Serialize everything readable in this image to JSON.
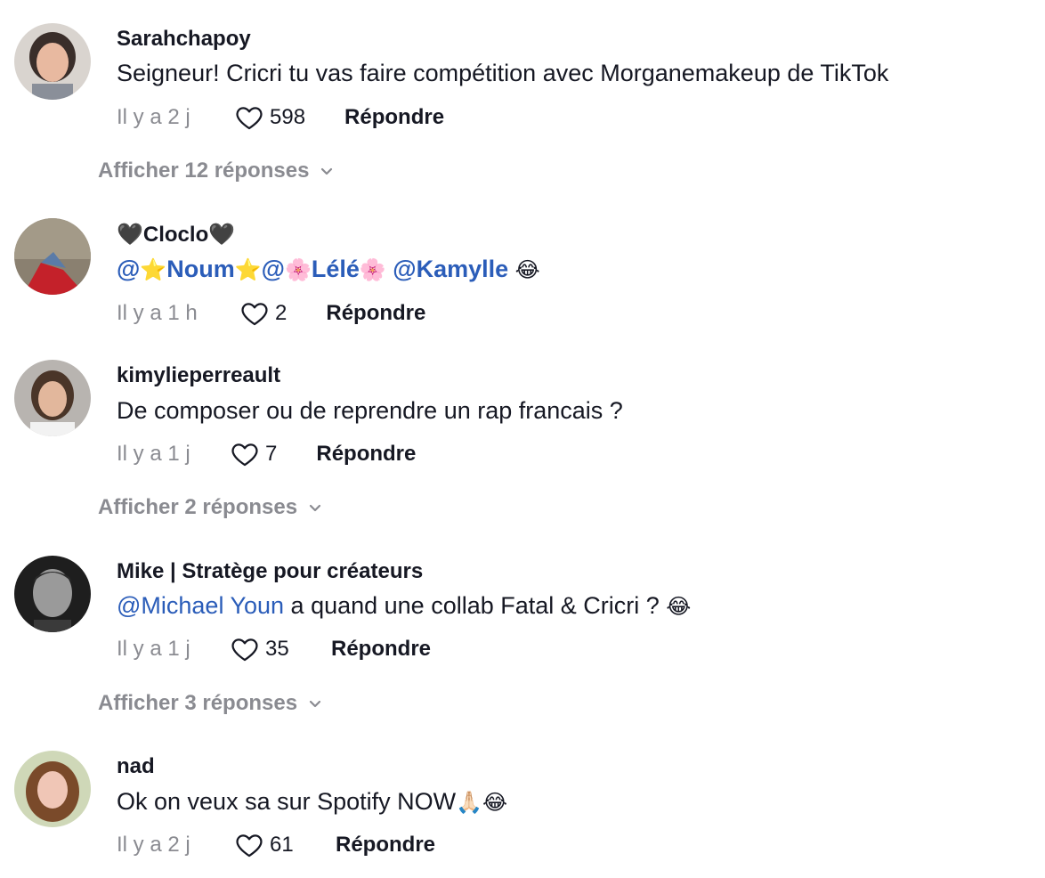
{
  "comments": [
    {
      "username": "Sarahchapoy",
      "text": "Seigneur! Cricri tu vas faire compétition avec Morganemakeup de TikTok",
      "time": "Il y a 2 j",
      "likes": "598",
      "reply": "Répondre",
      "show_replies": "Afficher 12 réponses"
    },
    {
      "username_prefix": "🖤",
      "username_name": "Cloclo",
      "username_suffix": "🖤",
      "mention1_pre": "@",
      "mention1_emoji_a": "⭐",
      "mention1_name": "Noum",
      "mention1_emoji_b": "⭐",
      "mention2_pre": "@",
      "mention2_emoji_a": "🌸",
      "mention2_name": "Lélé",
      "mention2_emoji_b": "🌸",
      "mention3": "@Kamylle",
      "text_emoji": "😂",
      "time": "Il y a 1 h",
      "likes": "2",
      "reply": "Répondre"
    },
    {
      "username": "kimylieperreault",
      "text": "De composer ou de reprendre un rap francais ?",
      "time": "Il y a 1 j",
      "likes": "7",
      "reply": "Répondre",
      "show_replies": "Afficher 2 réponses"
    },
    {
      "username": "Mike | Stratège pour créateurs",
      "mention": "@Michael Youn",
      "text": " a quand une collab Fatal & Cricri ? ",
      "text_emoji": "😂",
      "time": "Il y a 1 j",
      "likes": "35",
      "reply": "Répondre",
      "show_replies": "Afficher 3 réponses"
    },
    {
      "username": "nad",
      "text": "Ok on veux sa sur Spotify NOW",
      "text_emoji": "🙏🏻😂",
      "time": "Il y a 2 j",
      "likes": "61",
      "reply": "Répondre"
    }
  ],
  "colors": {
    "primary_text": "#161823",
    "secondary_text": "#8a8b91",
    "mention": "#2b5db9"
  },
  "icons": {
    "like": "heart-outline-icon",
    "expand": "chevron-down-icon"
  }
}
